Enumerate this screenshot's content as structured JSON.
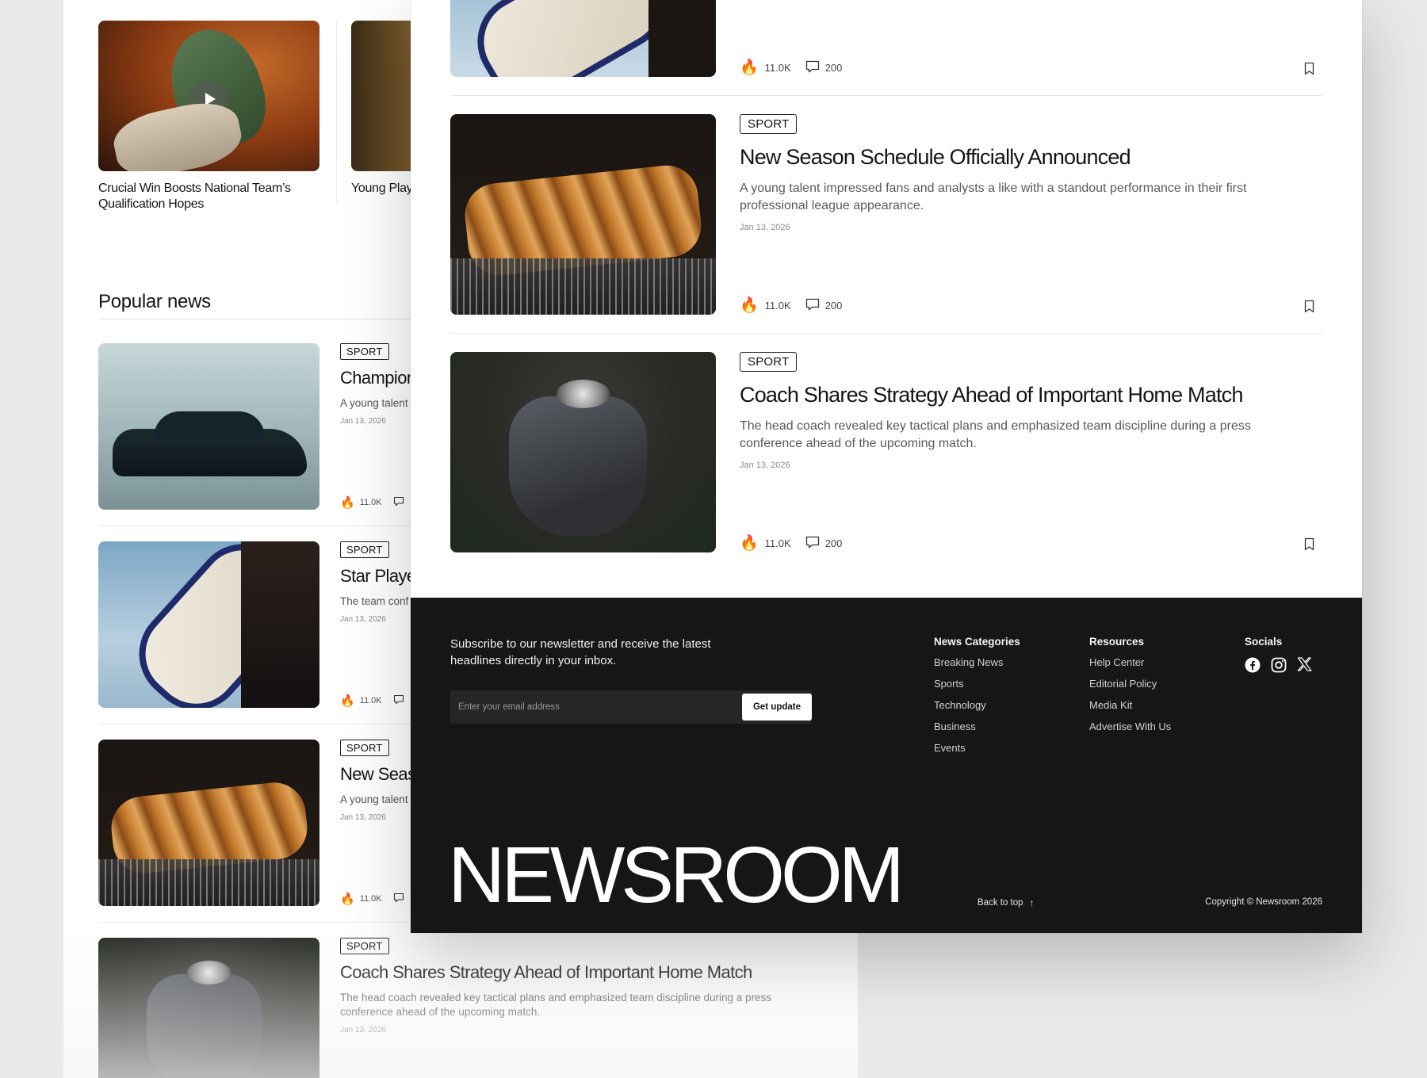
{
  "top_cards": [
    {
      "caption": "Crucial Win Boosts National Team’s Qualification Hopes"
    },
    {
      "caption": "Young Play Appearanc"
    }
  ],
  "popular": {
    "title": "Popular news",
    "items": [
      {
        "tag": "SPORT",
        "title": "Champion",
        "desc": "A young talent professional le",
        "date": "Jan 13, 2026",
        "likes": "11.0K"
      },
      {
        "tag": "SPORT",
        "title": "Star Playe",
        "desc": "The team conf injury during tr",
        "date": "Jan 13, 2026",
        "likes": "11.0K"
      },
      {
        "tag": "SPORT",
        "title": "New Seas",
        "desc": "A young talent professional le",
        "date": "Jan 13, 2026",
        "likes": "11.0K"
      },
      {
        "tag": "SPORT",
        "title": "Coach Shares Strategy Ahead of Important Home Match",
        "desc": "The head coach revealed key tactical plans and emphasized team discipline during a press conference ahead of the upcoming match.",
        "date": "Jan 13, 2026",
        "likes": ""
      }
    ]
  },
  "front": {
    "first_stats": {
      "likes": "11.0K",
      "comments": "200"
    },
    "articles": [
      {
        "tag": "SPORT",
        "title": "New Season Schedule Officially Announced",
        "desc": "A young talent impressed fans and analysts a like with a standout performance in their first professional league appearance.",
        "date": "Jan 13, 2026",
        "likes": "11.0K",
        "comments": "200"
      },
      {
        "tag": "SPORT",
        "title": "Coach Shares Strategy Ahead of Important Home Match",
        "desc": "The head coach revealed key tactical plans and emphasized team discipline during a press conference ahead of the upcoming match.",
        "date": "Jan 13, 2026",
        "likes": "11.0K",
        "comments": "200"
      }
    ]
  },
  "footer": {
    "newsletter_text": "Subscribe to our newsletter and receive the latest headlines directly in your inbox.",
    "email_placeholder": "Enter your email address",
    "submit_label": "Get update",
    "columns": [
      {
        "title": "News Categories",
        "links": [
          "Breaking News",
          "Sports",
          "Technology",
          "Business",
          "Events"
        ]
      },
      {
        "title": "Resources",
        "links": [
          "Help Center",
          "Editorial Policy",
          "Media Kit",
          "Advertise With Us"
        ]
      }
    ],
    "socials_title": "Socials",
    "socials": [
      "facebook-icon",
      "instagram-icon",
      "x-icon"
    ],
    "brand": "NEWSROOM",
    "back_to_top": "Back to top",
    "copyright": "Copyright © Newsroom 2026"
  },
  "colors": {
    "footer_bg": "#161616",
    "page_bg": "#e9e9e9",
    "fire": "#f26b1d"
  }
}
